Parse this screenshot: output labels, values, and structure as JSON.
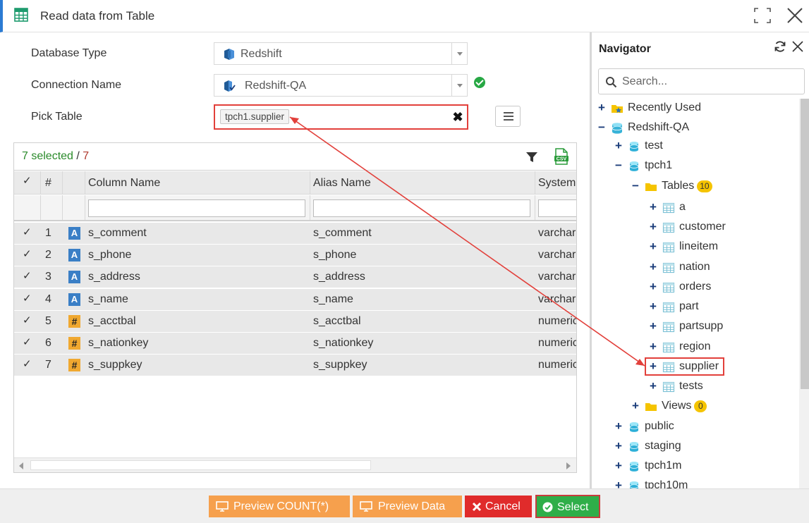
{
  "window": {
    "title": "Read data from Table"
  },
  "form": {
    "db_type_label": "Database Type",
    "db_type_value": "Redshift",
    "conn_label": "Connection Name",
    "conn_value": "Redshift-QA",
    "pick_label": "Pick Table",
    "pick_tag": "tpch1.supplier"
  },
  "grid": {
    "selected": "7 selected",
    "separator": " / ",
    "total": "7",
    "headers": {
      "num": "#",
      "column": "Column Name",
      "alias": "Alias Name",
      "system": "System"
    },
    "rows": [
      {
        "num": "1",
        "type": "A",
        "column": "s_comment",
        "alias": "s_comment",
        "system": "varchar"
      },
      {
        "num": "2",
        "type": "A",
        "column": "s_phone",
        "alias": "s_phone",
        "system": "varchar"
      },
      {
        "num": "3",
        "type": "A",
        "column": "s_address",
        "alias": "s_address",
        "system": "varchar"
      },
      {
        "num": "4",
        "type": "A",
        "column": "s_name",
        "alias": "s_name",
        "system": "varchar"
      },
      {
        "num": "5",
        "type": "#",
        "column": "s_acctbal",
        "alias": "s_acctbal",
        "system": "numeric"
      },
      {
        "num": "6",
        "type": "#",
        "column": "s_nationkey",
        "alias": "s_nationkey",
        "system": "numeric"
      },
      {
        "num": "7",
        "type": "#",
        "column": "s_suppkey",
        "alias": "s_suppkey",
        "system": "numeric"
      }
    ]
  },
  "navigator": {
    "title": "Navigator",
    "search_placeholder": "Search...",
    "tree": [
      {
        "label": "Recently Used",
        "icon": "star-folder-icon",
        "level": 0,
        "toggle": "+"
      },
      {
        "label": "Redshift-QA",
        "icon": "database-icon",
        "level": 0,
        "toggle": "−"
      },
      {
        "label": "test",
        "icon": "schema-icon",
        "level": 1,
        "toggle": "+"
      },
      {
        "label": "tpch1",
        "icon": "schema-icon",
        "level": 1,
        "toggle": "−"
      },
      {
        "label": "Tables",
        "icon": "folder-icon",
        "level": 2,
        "toggle": "−",
        "badge": "10"
      },
      {
        "label": "a",
        "icon": "table-icon",
        "level": 3,
        "toggle": "+"
      },
      {
        "label": "customer",
        "icon": "table-icon",
        "level": 3,
        "toggle": "+"
      },
      {
        "label": "lineitem",
        "icon": "table-icon",
        "level": 3,
        "toggle": "+"
      },
      {
        "label": "nation",
        "icon": "table-icon",
        "level": 3,
        "toggle": "+"
      },
      {
        "label": "orders",
        "icon": "table-icon",
        "level": 3,
        "toggle": "+"
      },
      {
        "label": "part",
        "icon": "table-icon",
        "level": 3,
        "toggle": "+"
      },
      {
        "label": "partsupp",
        "icon": "table-icon",
        "level": 3,
        "toggle": "+"
      },
      {
        "label": "region",
        "icon": "table-icon",
        "level": 3,
        "toggle": "+"
      },
      {
        "label": "supplier",
        "icon": "table-icon",
        "level": 3,
        "toggle": "+"
      },
      {
        "label": "tests",
        "icon": "table-icon",
        "level": 3,
        "toggle": "+"
      },
      {
        "label": "Views",
        "icon": "folder-icon",
        "level": 2,
        "toggle": "+",
        "badge": "0"
      },
      {
        "label": "public",
        "icon": "schema-icon",
        "level": 1,
        "toggle": "+"
      },
      {
        "label": "staging",
        "icon": "schema-icon",
        "level": 1,
        "toggle": "+"
      },
      {
        "label": "tpch1m",
        "icon": "schema-icon",
        "level": 1,
        "toggle": "+"
      },
      {
        "label": "tpch10m",
        "icon": "schema-icon",
        "level": 1,
        "toggle": "+"
      }
    ]
  },
  "footer": {
    "preview_count": "Preview COUNT(*)",
    "preview_data": "Preview Data",
    "cancel": "Cancel",
    "select": "Select"
  },
  "colors": {
    "accent": "#2b7bd3",
    "highlight": "#e2403b",
    "orange": "#f6a04d",
    "red": "#e02b2b",
    "green": "#2fae49"
  }
}
